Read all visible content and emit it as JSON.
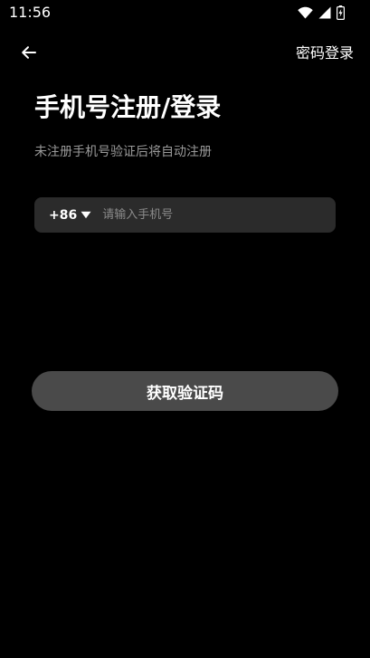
{
  "status_bar": {
    "time": "11:56",
    "icons": [
      "wifi-icon",
      "signal-icon",
      "battery-charging-icon"
    ]
  },
  "nav": {
    "back_icon": "arrow-left-icon",
    "password_login_label": "密码登录"
  },
  "header": {
    "title": "手机号注册/登录",
    "subtitle": "未注册手机号验证后将自动注册"
  },
  "phone_form": {
    "country_code": "+86",
    "country_code_icon": "caret-down-icon",
    "phone_placeholder": "请输入手机号",
    "phone_value": ""
  },
  "actions": {
    "get_code_label": "获取验证码"
  },
  "colors": {
    "background": "#000000",
    "input_background": "#2b2b2b",
    "button_background": "#4a4a4a",
    "subtitle_text": "#9a9a9a",
    "placeholder_text": "#8a8a8a"
  }
}
